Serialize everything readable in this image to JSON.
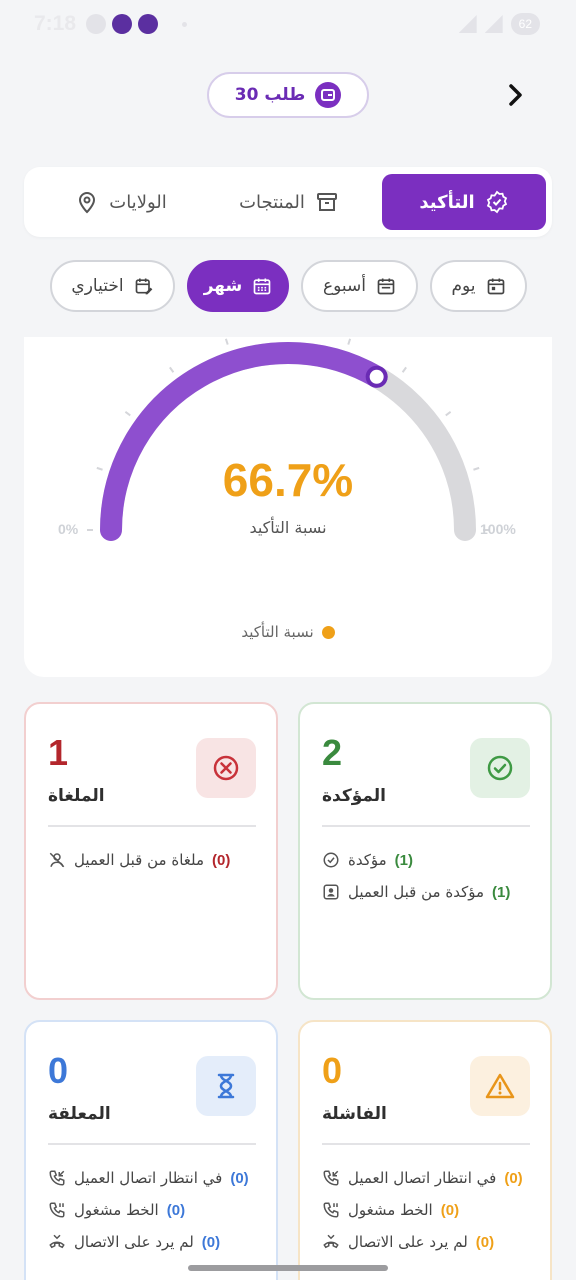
{
  "status_bar": {
    "time": "7:18",
    "battery": "62"
  },
  "header": {
    "orders_label": "30 طلب"
  },
  "tabs": [
    {
      "label": "التأكيد",
      "active": true,
      "icon": "badge-check-icon"
    },
    {
      "label": "المنتجات",
      "active": false,
      "icon": "archive-icon"
    },
    {
      "label": "الولايات",
      "active": false,
      "icon": "map-pin-icon"
    }
  ],
  "periods": [
    {
      "label": "يوم",
      "active": false,
      "icon": "calendar-day-icon"
    },
    {
      "label": "أسبوع",
      "active": false,
      "icon": "calendar-week-icon"
    },
    {
      "label": "شهر",
      "active": true,
      "icon": "calendar-month-icon"
    },
    {
      "label": "اختياري",
      "active": false,
      "icon": "calendar-edit-icon"
    }
  ],
  "gauge": {
    "value_text": "66.7%",
    "value": 0.667,
    "caption": "نسبة التأكيد",
    "min_label": "0%",
    "max_label": "100%",
    "legend_label": "نسبة التأكيد",
    "colors": {
      "fill": "#8e4fcf",
      "track": "#d9d9dc",
      "value": "#efa018"
    }
  },
  "cards": {
    "confirmed": {
      "count": "2",
      "title": "المؤكدة",
      "color": "#3a8a3e",
      "details": [
        {
          "num": "(1)",
          "label": "مؤكدة",
          "icon": "badge-check-icon"
        },
        {
          "num": "(1)",
          "label": "مؤكدة من قبل العميل",
          "icon": "user-badge-icon"
        }
      ]
    },
    "cancelled": {
      "count": "1",
      "title": "الملغاة",
      "color": "#b3262c",
      "details": [
        {
          "num": "(0)",
          "label": "ملغاة من قبل العميل",
          "icon": "user-off-icon"
        }
      ]
    },
    "failed": {
      "count": "0",
      "title": "الفاشلة",
      "color": "#efa018",
      "details": [
        {
          "num": "(0)",
          "label": "في انتظار اتصال العميل",
          "icon": "phone-incoming-icon"
        },
        {
          "num": "(0)",
          "label": "الخط مشغول",
          "icon": "phone-pause-icon"
        },
        {
          "num": "(0)",
          "label": "لم يرد على الاتصال",
          "icon": "phone-missed-icon"
        }
      ]
    },
    "pending": {
      "count": "0",
      "title": "المعلقة",
      "color": "#3d78d8",
      "details": [
        {
          "num": "(0)",
          "label": "في انتظار اتصال العميل",
          "icon": "phone-incoming-icon"
        },
        {
          "num": "(0)",
          "label": "الخط مشغول",
          "icon": "phone-pause-icon"
        },
        {
          "num": "(0)",
          "label": "لم يرد على الاتصال",
          "icon": "phone-missed-icon"
        }
      ]
    }
  }
}
